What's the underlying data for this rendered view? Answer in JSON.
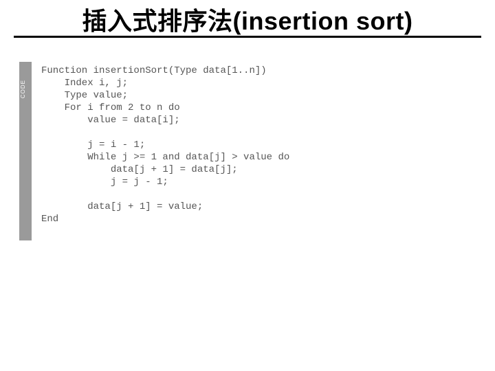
{
  "title": "插入式排序法(insertion sort)",
  "gutter_label": "CODE",
  "code_lines": [
    "Function insertionSort(Type data[1..n])",
    "    Index i, j;",
    "    Type value;",
    "    For i from 2 to n do",
    "        value = data[i];",
    "",
    "        j = i - 1;",
    "        While j >= 1 and data[j] > value do",
    "            data[j + 1] = data[j];",
    "            j = j - 1;",
    "",
    "        data[j + 1] = value;",
    "End"
  ]
}
